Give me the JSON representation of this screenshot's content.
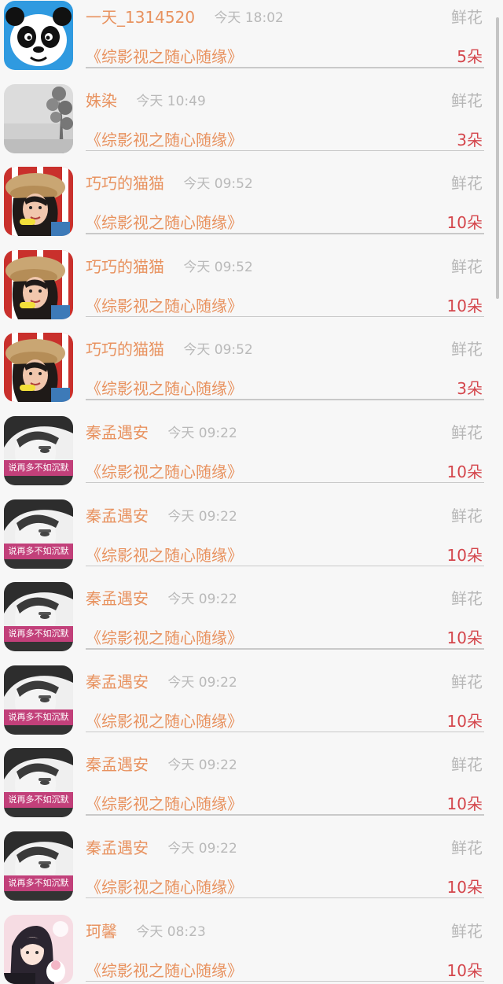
{
  "gift_list": {
    "rows": [
      {
        "avatar": "panda-avatar",
        "avatar_caption": "",
        "username": "一天_1314520",
        "time": "今天 18:02",
        "gift_type": "鲜花",
        "book": "《综影视之随心随缘》",
        "count": "5朵"
      },
      {
        "avatar": "foggy-tree-avatar",
        "avatar_caption": "",
        "username": "姝染",
        "time": "今天 10:49",
        "gift_type": "鲜花",
        "book": "《综影视之随心随缘》",
        "count": "3朵"
      },
      {
        "avatar": "girl-hat-avatar",
        "avatar_caption": "",
        "username": "巧巧的猫猫",
        "time": "今天 09:52",
        "gift_type": "鲜花",
        "book": "《综影视之随心随缘》",
        "count": "10朵"
      },
      {
        "avatar": "girl-hat-avatar",
        "avatar_caption": "",
        "username": "巧巧的猫猫",
        "time": "今天 09:52",
        "gift_type": "鲜花",
        "book": "《综影视之随心随缘》",
        "count": "10朵"
      },
      {
        "avatar": "girl-hat-avatar",
        "avatar_caption": "",
        "username": "巧巧的猫猫",
        "time": "今天 09:52",
        "gift_type": "鲜花",
        "book": "《综影视之随心随缘》",
        "count": "3朵"
      },
      {
        "avatar": "bw-face-avatar",
        "avatar_caption": "说再多不如沉默",
        "username": "秦孟遇安",
        "time": "今天 09:22",
        "gift_type": "鲜花",
        "book": "《综影视之随心随缘》",
        "count": "10朵"
      },
      {
        "avatar": "bw-face-avatar",
        "avatar_caption": "说再多不如沉默",
        "username": "秦孟遇安",
        "time": "今天 09:22",
        "gift_type": "鲜花",
        "book": "《综影视之随心随缘》",
        "count": "10朵"
      },
      {
        "avatar": "bw-face-avatar",
        "avatar_caption": "说再多不如沉默",
        "username": "秦孟遇安",
        "time": "今天 09:22",
        "gift_type": "鲜花",
        "book": "《综影视之随心随缘》",
        "count": "10朵"
      },
      {
        "avatar": "bw-face-avatar",
        "avatar_caption": "说再多不如沉默",
        "username": "秦孟遇安",
        "time": "今天 09:22",
        "gift_type": "鲜花",
        "book": "《综影视之随心随缘》",
        "count": "10朵"
      },
      {
        "avatar": "bw-face-avatar",
        "avatar_caption": "说再多不如沉默",
        "username": "秦孟遇安",
        "time": "今天 09:22",
        "gift_type": "鲜花",
        "book": "《综影视之随心随缘》",
        "count": "10朵"
      },
      {
        "avatar": "bw-face-avatar",
        "avatar_caption": "说再多不如沉默",
        "username": "秦孟遇安",
        "time": "今天 09:22",
        "gift_type": "鲜花",
        "book": "《综影视之随心随缘》",
        "count": "10朵"
      },
      {
        "avatar": "anime-couple-avatar",
        "avatar_caption": "",
        "username": "珂馨",
        "time": "今天 08:23",
        "gift_type": "鲜花",
        "book": "《综影视之随心随缘》",
        "count": "10朵"
      }
    ]
  },
  "colors": {
    "background": "#f7f7f7",
    "username": "#e8925f",
    "time": "#b9b9b9",
    "gift_type": "#b7b7b7",
    "book": "#e8925f",
    "count": "#d4464c",
    "divider": "#c9c9c9"
  }
}
